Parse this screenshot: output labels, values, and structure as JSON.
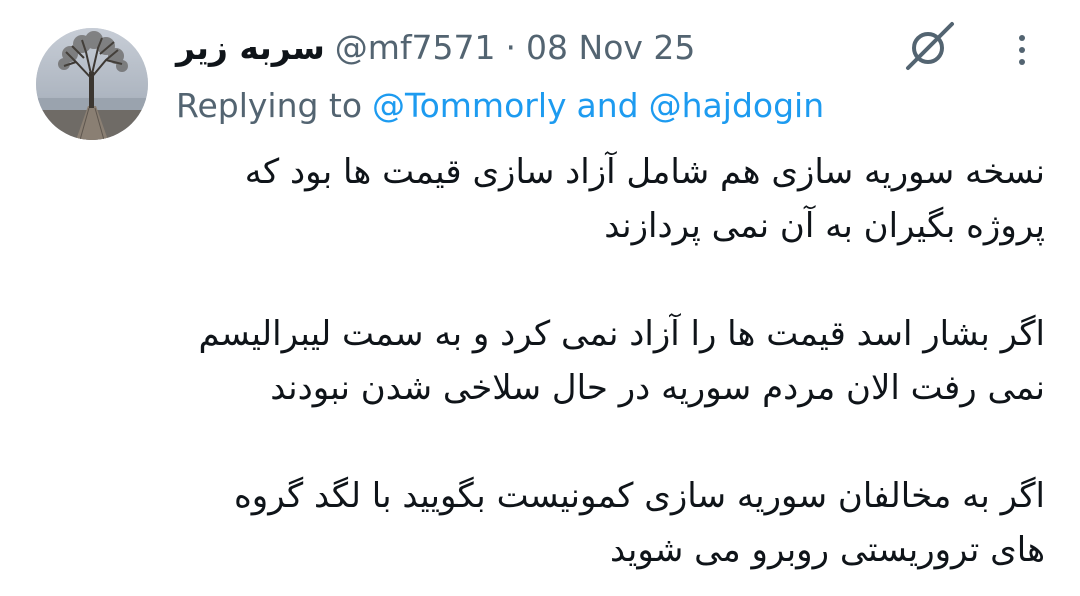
{
  "author": {
    "display_name": "سربه زیر",
    "handle": "@mf7571",
    "separator": "·",
    "date": "08 Nov 25"
  },
  "reply": {
    "prefix": "Replying to",
    "mention_1": "@Tommorly",
    "joiner": "and",
    "mention_2": "@hajdogin"
  },
  "icons": {
    "grok": "grok-icon",
    "more": "more-options-icon"
  },
  "colors": {
    "text": "#0f1419",
    "secondary": "#536471",
    "link": "#1d9bf0"
  },
  "tweet_text": {
    "p1_line1": "نسخه سوریه سازی هم شامل آزاد سازی قیمت ها بود که",
    "p1_line2": "پروژه بگیران به آن نمی پردازند",
    "p2_line1": "اگر بشار اسد قیمت ها را آزاد نمی کرد و به سمت لیبرالیسم",
    "p2_line2": "نمی رفت الان مردم سوریه در حال سلاخی شدن نبودند",
    "p3_line1": "اگر به مخالفان سوریه سازی کمونیست بگویید با لگد گروه",
    "p3_line2": "های تروریستی روبرو می شوید"
  }
}
